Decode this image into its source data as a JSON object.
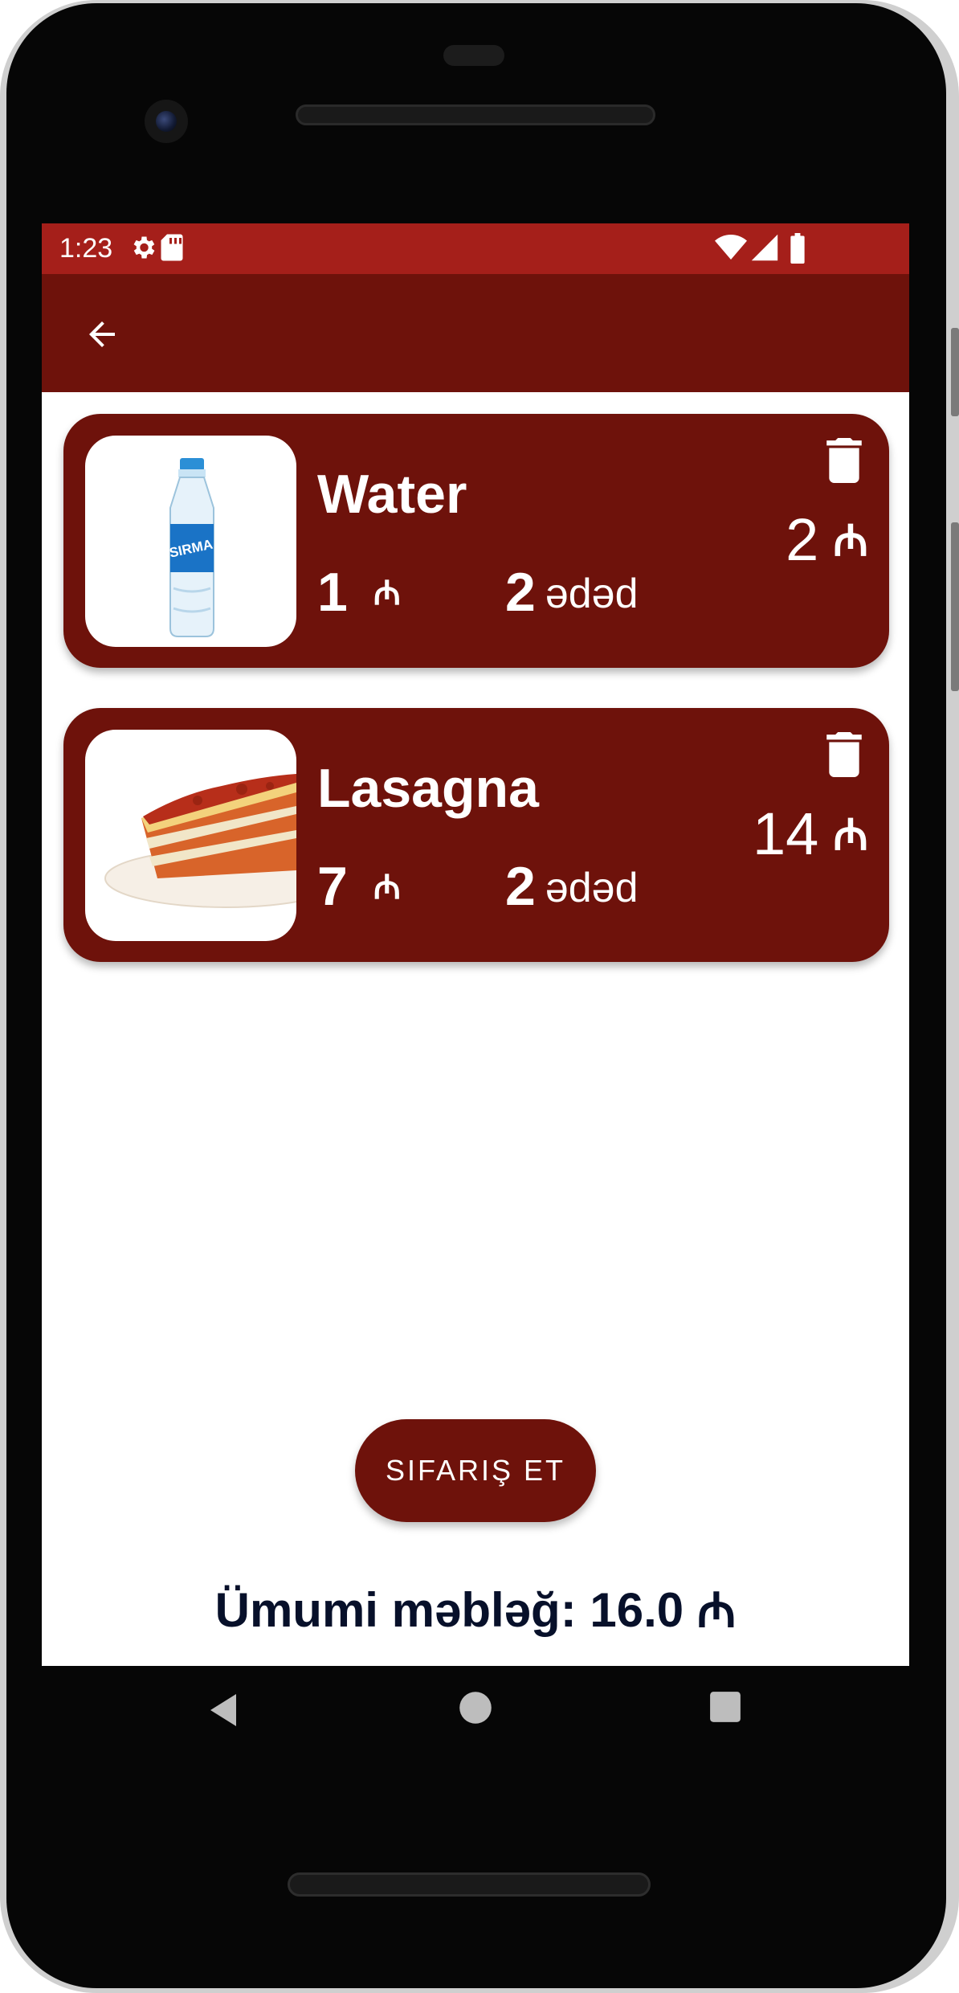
{
  "status_bar": {
    "time": "1:23",
    "icons": [
      "gear-icon",
      "sd-card-icon",
      "wifi-icon",
      "cell-signal-icon",
      "battery-icon"
    ],
    "color": "#a51f1a"
  },
  "app_bar": {
    "back_icon": "arrow-back-icon",
    "color": "#6e120b"
  },
  "cart": {
    "items": [
      {
        "name": "Water",
        "image": "water-bottle-image",
        "unit_price": "1",
        "currency": "₼",
        "quantity": "2",
        "quantity_unit": "ədəd",
        "line_total": "2",
        "delete_icon": "trash-icon"
      },
      {
        "name": "Lasagna",
        "image": "lasagna-image",
        "unit_price": "7",
        "currency": "₼",
        "quantity": "2",
        "quantity_unit": "ədəd",
        "line_total": "14",
        "delete_icon": "trash-icon"
      }
    ]
  },
  "order_button": {
    "label": "SIFARIŞ ET"
  },
  "summary": {
    "total_text": "Ümumi məbləğ: 16.0 ₼"
  },
  "nav": {
    "back": "triangle-back-icon",
    "home": "circle-home-icon",
    "recents": "square-recents-icon"
  },
  "colors": {
    "primary_dark": "#6e120b",
    "status_red": "#a51f1a",
    "total_text": "#07102a"
  }
}
